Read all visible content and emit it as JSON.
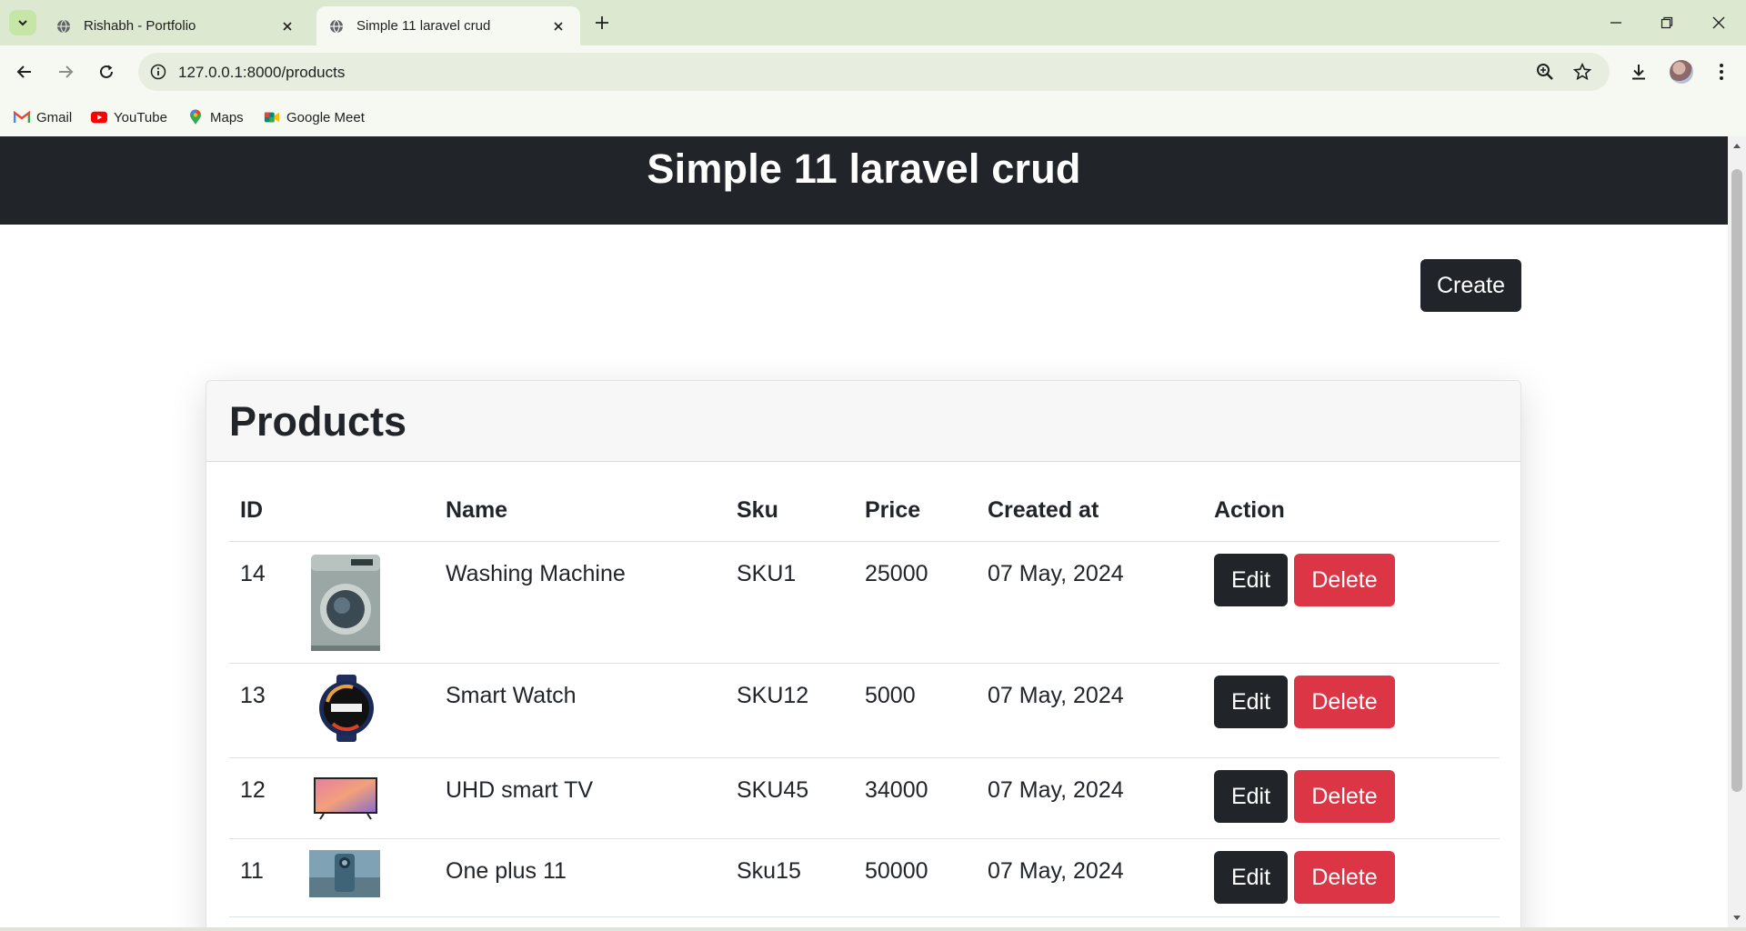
{
  "browser": {
    "tabs": [
      {
        "title": "Rishabh - Portfolio",
        "active": false
      },
      {
        "title": "Simple 11 laravel crud",
        "active": true
      }
    ],
    "url": "127.0.0.1:8000/products",
    "bookmarks": [
      {
        "label": "Gmail",
        "icon": "gmail-icon"
      },
      {
        "label": "YouTube",
        "icon": "youtube-icon"
      },
      {
        "label": "Maps",
        "icon": "maps-icon"
      },
      {
        "label": "Google Meet",
        "icon": "google-meet-icon"
      }
    ]
  },
  "page": {
    "site_title": "Simple 11 laravel crud",
    "create_label": "Create",
    "card_title": "Products",
    "columns": [
      "ID",
      "",
      "Name",
      "Sku",
      "Price",
      "Created at",
      "Action"
    ],
    "edit_label": "Edit",
    "delete_label": "Delete",
    "products": [
      {
        "id": "14",
        "name": "Washing Machine",
        "sku": "SKU1",
        "price": "25000",
        "created_at": "07 May, 2024",
        "image": "washing-machine-image"
      },
      {
        "id": "13",
        "name": "Smart Watch",
        "sku": "SKU12",
        "price": "5000",
        "created_at": "07 May, 2024",
        "image": "smart-watch-image"
      },
      {
        "id": "12",
        "name": "UHD smart TV",
        "sku": "SKU45",
        "price": "34000",
        "created_at": "07 May, 2024",
        "image": "tv-image"
      },
      {
        "id": "11",
        "name": "One plus 11",
        "sku": "Sku15",
        "price": "50000",
        "created_at": "07 May, 2024",
        "image": "phone-image"
      }
    ]
  },
  "colors": {
    "header_bg": "#212529",
    "danger": "#dc3545",
    "tabbar": "#dce8d0"
  }
}
